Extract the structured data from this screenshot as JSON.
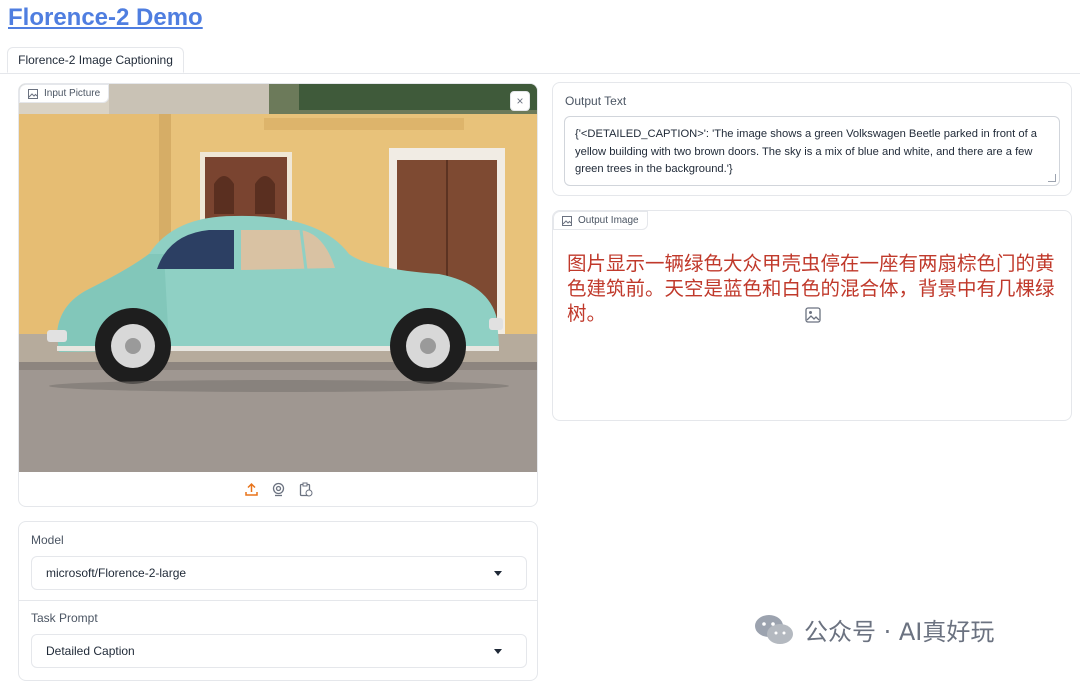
{
  "app": {
    "title": "Florence-2 Demo"
  },
  "tabs": [
    {
      "label": "Florence-2 Image Captioning"
    }
  ],
  "input_panel": {
    "label": "Input Picture",
    "close_glyph": "×"
  },
  "upload_toolbar": {
    "icons": [
      "upload-icon",
      "webcam-icon",
      "clipboard-icon"
    ],
    "accent": "#e8731a"
  },
  "model": {
    "label": "Model",
    "value": "microsoft/Florence-2-large"
  },
  "task": {
    "label": "Task Prompt",
    "value": "Detailed Caption"
  },
  "output_text": {
    "label": "Output Text",
    "value": "{'<DETAILED_CAPTION>': 'The image shows a green Volkswagen Beetle parked in front of a yellow building with two brown doors. The sky is a mix of blue and white, and there are a few green trees in the background.'}"
  },
  "output_image": {
    "label": "Output Image",
    "caption": "图片显示一辆绿色大众甲壳虫停在一座有两扇棕色门的黄色建筑前。天空是蓝色和白色的混合体，背景中有几棵绿树。"
  },
  "watermark": {
    "text": "公众号 · AI真好玩"
  },
  "colors": {
    "title_link": "#4f7ee0",
    "caption_red": "#c0392b",
    "car_teal": "#8fd0c4",
    "wall_yellow": "#e8c27a",
    "door_brown": "#7a4430"
  }
}
